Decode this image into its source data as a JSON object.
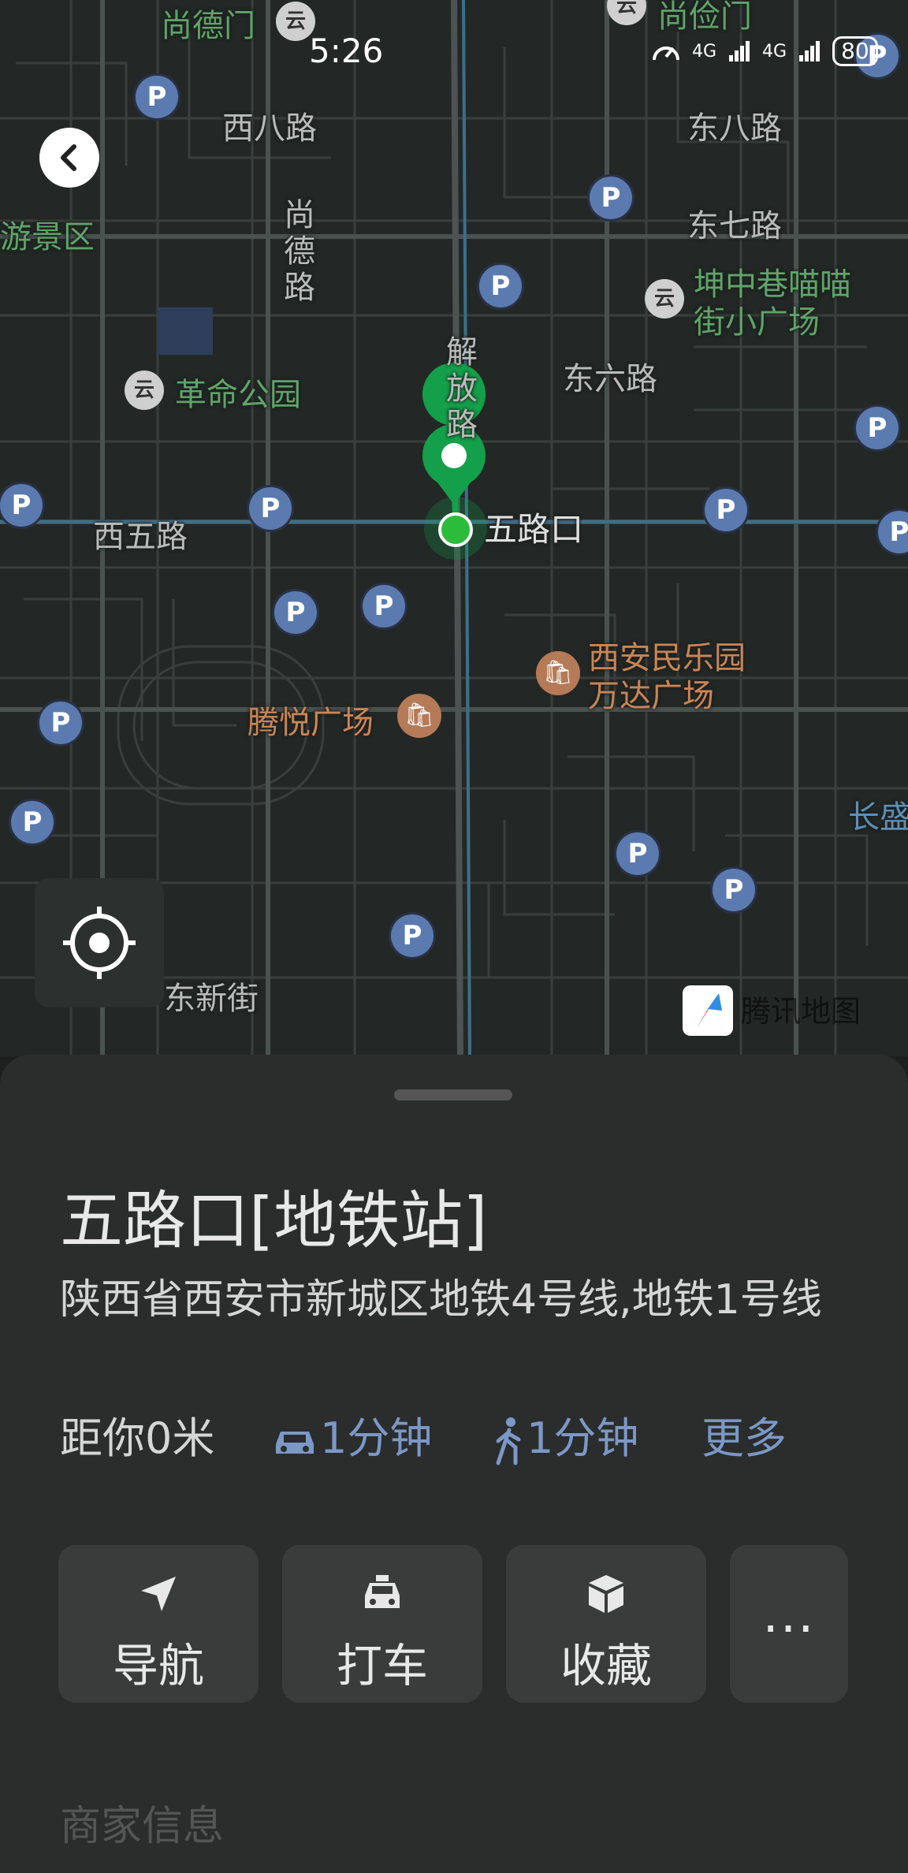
{
  "status_bar": {
    "time": "5:26",
    "network_1": "4G",
    "network_2": "4G",
    "battery": "80"
  },
  "map": {
    "labels": {
      "shangdemen": "尚德门",
      "shangqinmen": "尚俭门",
      "xibalu": "西八路",
      "dongbalu": "东八路",
      "dongqilu": "东七路",
      "youjingqu": "游景区",
      "shangdelu": "尚德路",
      "kunzhongxiang": "坤中巷喵喵",
      "jiexiaoguangchang": "街小广场",
      "jiefanglu": "解放路",
      "dongliulu": "东六路",
      "geminggongyuan": "革命公园",
      "xiwulu": "西五路",
      "wulukou": "五路口",
      "minleyuan1": "西安民乐园",
      "minleyuan2": "万达广场",
      "tengyue": "腾悦广场",
      "changsheng": "长盛",
      "dongxinjie": "东新街"
    },
    "parking_symbol": "P",
    "subway_symbol": "云",
    "logo_text": "腾讯地图"
  },
  "place": {
    "title": "五路口[地铁站]",
    "address": "陕西省西安市新城区地铁4号线,地铁1号线",
    "distance": "距你0米",
    "drive_time": "1分钟",
    "walk_time": "1分钟",
    "more": "更多"
  },
  "actions": {
    "navigate": "导航",
    "taxi": "打车",
    "favorite": "收藏",
    "more_icon": "..."
  },
  "section": {
    "merchant_info": "商家信息"
  },
  "colors": {
    "accent": "#7b98c6",
    "route_green": "#14a04a",
    "map_bg": "#232826",
    "sheet_bg": "#2b2c2c"
  }
}
